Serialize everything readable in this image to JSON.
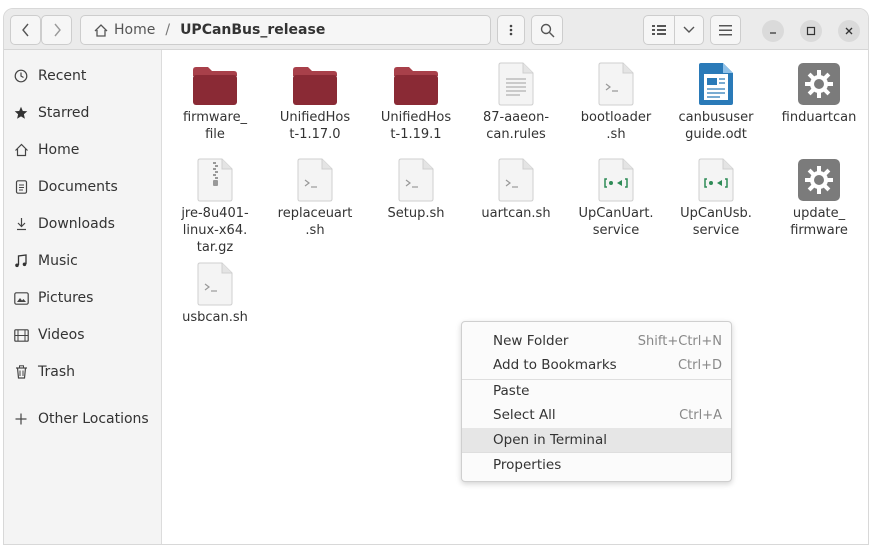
{
  "header": {
    "path_home": "Home",
    "path_separator": "/",
    "path_current": "UPCanBus_release"
  },
  "sidebar": {
    "items": [
      {
        "label": "Recent",
        "icon": "clock-icon"
      },
      {
        "label": "Starred",
        "icon": "star-icon"
      },
      {
        "label": "Home",
        "icon": "home-icon"
      },
      {
        "label": "Documents",
        "icon": "document-icon"
      },
      {
        "label": "Downloads",
        "icon": "download-icon"
      },
      {
        "label": "Music",
        "icon": "music-icon"
      },
      {
        "label": "Pictures",
        "icon": "picture-icon"
      },
      {
        "label": "Videos",
        "icon": "video-icon"
      },
      {
        "label": "Trash",
        "icon": "trash-icon"
      },
      {
        "label": "Other Locations",
        "icon": "plus-icon"
      }
    ]
  },
  "files": [
    {
      "name": "firmware_\nfile",
      "type": "folder"
    },
    {
      "name": "UnifiedHos\nt-1.17.0",
      "type": "folder"
    },
    {
      "name": "UnifiedHos\nt-1.19.1",
      "type": "folder"
    },
    {
      "name": "87-aaeon-\ncan.rules",
      "type": "text"
    },
    {
      "name": "bootloader\n.sh",
      "type": "script"
    },
    {
      "name": "canbususer\nguide.odt",
      "type": "odt"
    },
    {
      "name": "finduartcan",
      "type": "executable"
    },
    {
      "name": "jre-8u401-\nlinux-x64.\ntar.gz",
      "type": "archive"
    },
    {
      "name": "replaceuart\n.sh",
      "type": "script"
    },
    {
      "name": "Setup.sh",
      "type": "script"
    },
    {
      "name": "uartcan.sh",
      "type": "script"
    },
    {
      "name": "UpCanUart.\nservice",
      "type": "service"
    },
    {
      "name": "UpCanUsb.\nservice",
      "type": "service"
    },
    {
      "name": "update_\nfirmware",
      "type": "executable"
    },
    {
      "name": "usbcan.sh",
      "type": "script"
    }
  ],
  "context_menu": {
    "items": [
      {
        "label": "New Folder",
        "shortcut": "Shift+Ctrl+N"
      },
      {
        "label": "Add to Bookmarks",
        "shortcut": "Ctrl+D"
      },
      {
        "label": "Paste",
        "shortcut": ""
      },
      {
        "label": "Select All",
        "shortcut": "Ctrl+A"
      },
      {
        "label": "Open in Terminal",
        "shortcut": ""
      },
      {
        "label": "Properties",
        "shortcut": ""
      }
    ],
    "highlighted": "Open in Terminal"
  },
  "colors": {
    "folder": "#8a2a35",
    "folder_top": "#a8404a",
    "odt_blue": "#2a7ab8",
    "service_green": "#2e8b57",
    "executable_gray": "#7b7b7b"
  }
}
